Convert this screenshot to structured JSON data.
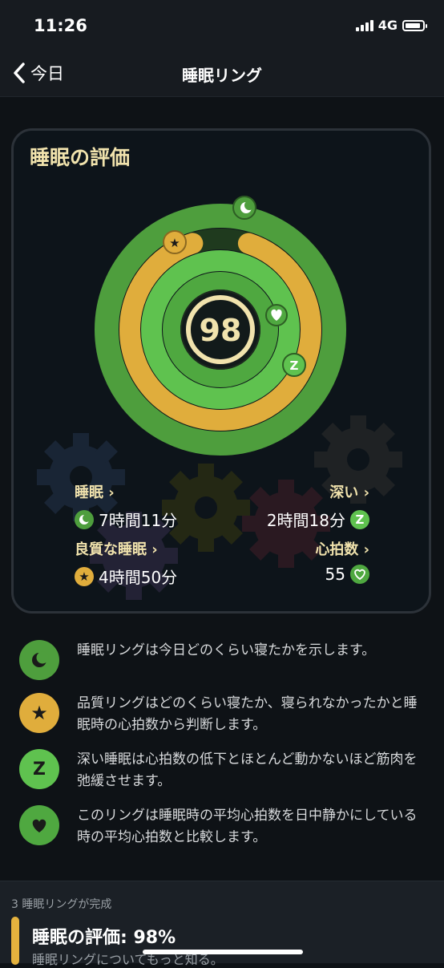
{
  "status": {
    "time": "11:26",
    "network": "4G"
  },
  "nav": {
    "back_label": "今日",
    "title": "睡眠リング"
  },
  "card": {
    "title": "睡眠の評価",
    "score": "98",
    "stats": {
      "sleep": {
        "label": "睡眠 ›",
        "value": "7時間11分"
      },
      "deep": {
        "label": "深い ›",
        "value": "2時間18分"
      },
      "quality": {
        "label": "良質な睡眠 ›",
        "value": "4時間50分"
      },
      "heart": {
        "label": "心拍数 ›",
        "value": "55"
      }
    },
    "rings": {
      "sleep_progress": 0.995,
      "quality_progress": 0.9,
      "deep_progress": 1.0,
      "heart_progress": 0.98
    },
    "icons": {
      "moon": "moon-icon",
      "star": "star-icon",
      "z": "z-icon",
      "heart": "heart-icon"
    }
  },
  "legend": [
    {
      "icon": "moon-icon",
      "text": "睡眠リングは今日どのくらい寝たかを示します。"
    },
    {
      "icon": "star-icon",
      "text": "品質リングはどのくらい寝たか、寝られなかったかと睡眠時の心拍数から判断します。"
    },
    {
      "icon": "z-icon",
      "text": "深い睡眠は心拍数の低下とほとんど動かないほど筋肉を弛緩させます。"
    },
    {
      "icon": "heart-icon",
      "text": "このリングは睡眠時の平均心拍数を日中静かにしている時の平均心拍数と比較します。"
    }
  ],
  "bottom": {
    "caption": "3 睡眠リングが完成",
    "heading": "睡眠の評価: 98%",
    "sub": "睡眠リングについてもっと知る。"
  },
  "colors": {
    "green_dark": "#4e9e3d",
    "green_light": "#5fc24f",
    "gold": "#e0ad3c",
    "cream": "#f1e3ad"
  }
}
